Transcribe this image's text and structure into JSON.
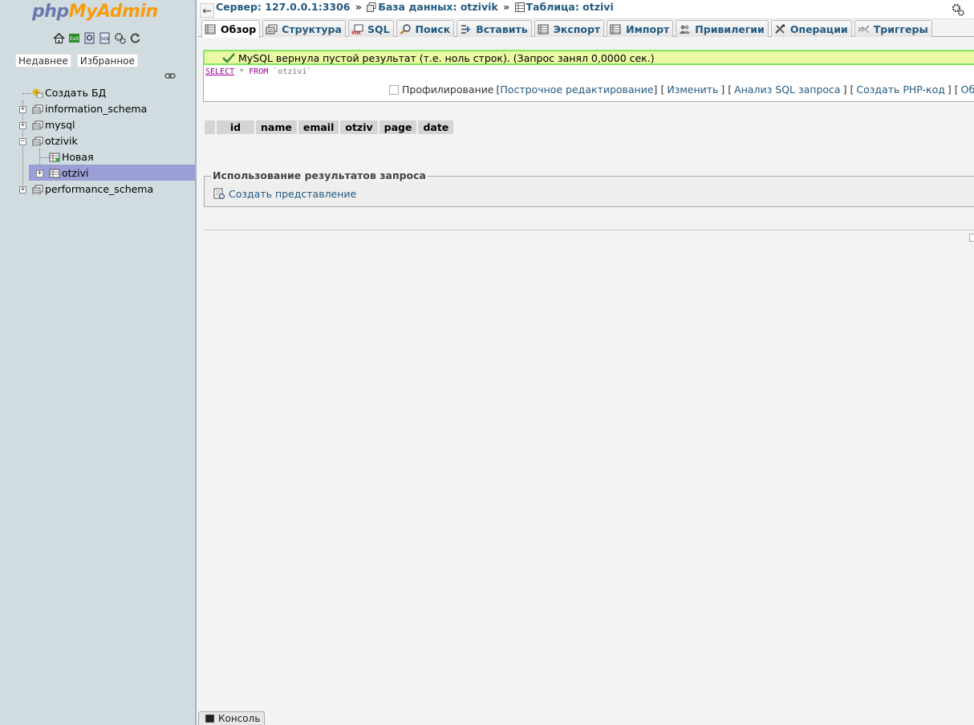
{
  "logo": {
    "php": "php",
    "my": "My",
    "admin": "Admin"
  },
  "sidebar": {
    "icons": [
      "home-icon",
      "exit-icon",
      "docs-icon",
      "sql-docs-icon",
      "settings-icon",
      "reload-icon"
    ],
    "tabs": [
      "Недавнее",
      "Избранное"
    ],
    "tree": [
      {
        "label": "Создать БД",
        "icon": "new-db-icon"
      },
      {
        "label": "information_schema",
        "icon": "database-icon"
      },
      {
        "label": "mysql",
        "icon": "database-icon"
      },
      {
        "label": "otzivik",
        "icon": "database-icon"
      },
      {
        "label": "Новая",
        "icon": "new-table-icon"
      },
      {
        "label": "otzivi",
        "icon": "table-icon"
      },
      {
        "label": "performance_schema",
        "icon": "database-icon"
      }
    ]
  },
  "breadcrumb": {
    "server": "Сервер: 127.0.0.1:3306",
    "sep": "»",
    "database": "База данных: otzivik",
    "table": "Таблица: otzivi"
  },
  "tabs": [
    {
      "label": "Обзор",
      "icon": "browse-icon",
      "active": true
    },
    {
      "label": "Структура",
      "icon": "structure-icon"
    },
    {
      "label": "SQL",
      "icon": "sql-icon"
    },
    {
      "label": "Поиск",
      "icon": "search-icon"
    },
    {
      "label": "Вставить",
      "icon": "insert-icon"
    },
    {
      "label": "Экспорт",
      "icon": "export-icon"
    },
    {
      "label": "Импорт",
      "icon": "import-icon"
    },
    {
      "label": "Привилегии",
      "icon": "privileges-icon"
    },
    {
      "label": "Операции",
      "icon": "operations-icon"
    },
    {
      "label": "Триггеры",
      "icon": "triggers-icon"
    }
  ],
  "message": {
    "success": "MySQL вернула пустой результат (т.е. ноль строк). (Запрос занял 0,0000 сек.)",
    "sql_select": "SELECT",
    "sql_rest": " * ",
    "sql_from": "FROM",
    "sql_table": " `otzivi`"
  },
  "sql_links": {
    "profiling": "Профилирование",
    "inline_edit": "Построчное редактирование",
    "edit": "Изменить",
    "explain": "Анализ SQL запроса",
    "php_code": "Создать PHP-код",
    "refresh": "Обновит"
  },
  "results": {
    "columns": [
      "id",
      "name",
      "email",
      "otziv",
      "page",
      "date"
    ]
  },
  "query_results": {
    "legend": "Использование результатов запроса",
    "create_view": "Создать представление"
  },
  "console": {
    "label": "Консоль"
  },
  "colors": {
    "link": "#235a81",
    "success_bg": "#ebf8a4",
    "success_border": "#7ee95a",
    "selected_row": "#9b9fd6",
    "sidebar_bg": "#d0dce0"
  }
}
